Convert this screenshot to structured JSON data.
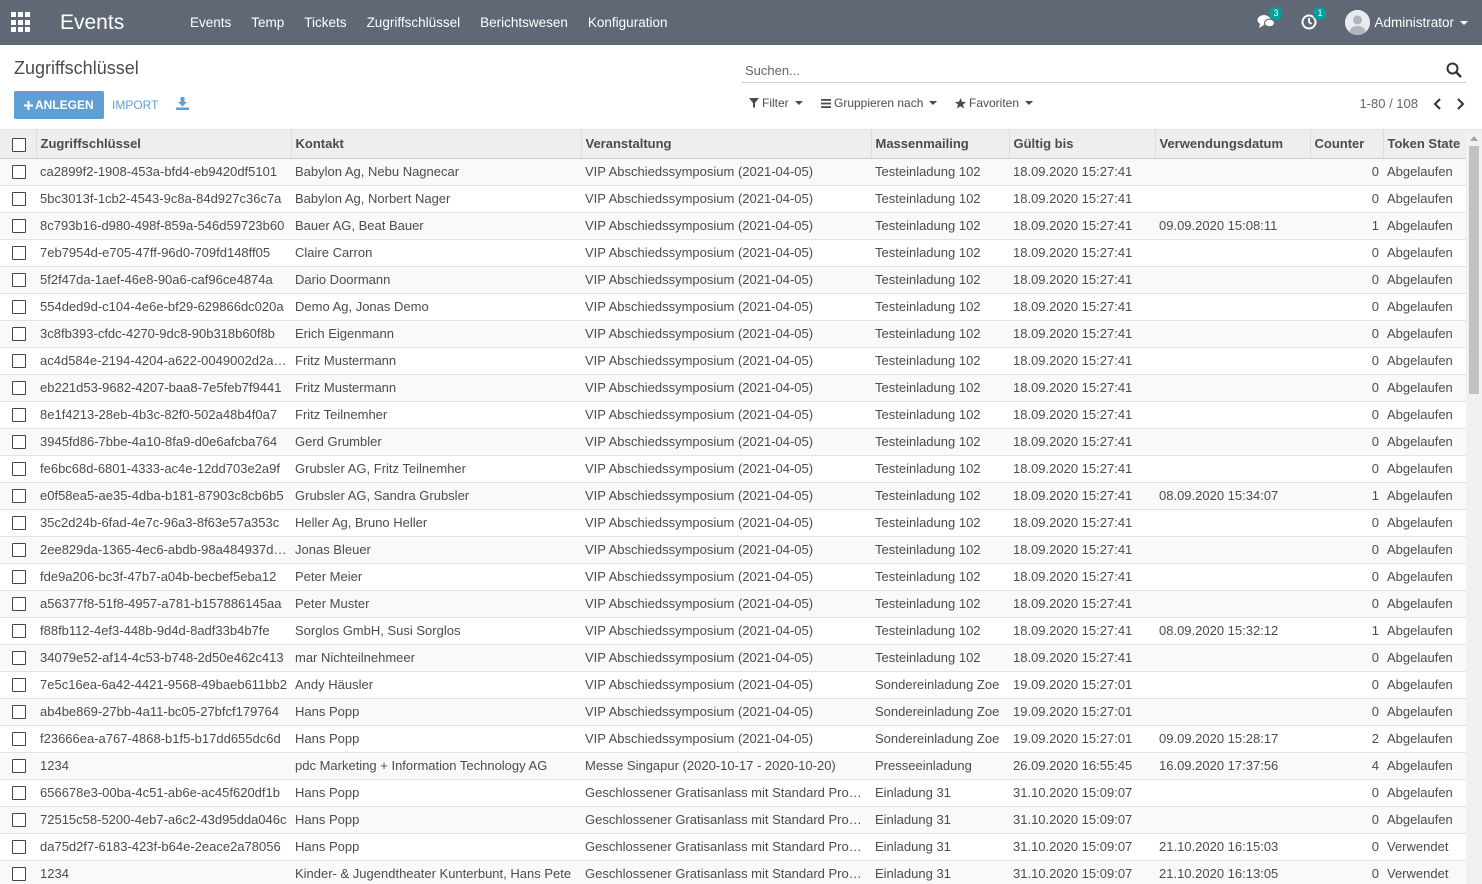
{
  "app": {
    "title": "Events",
    "menu": [
      "Events",
      "Temp",
      "Tickets",
      "Zugriffschlüssel",
      "Berichtswesen",
      "Konfiguration"
    ],
    "messages_count": "3",
    "activities_count": "1",
    "user_name": "Administrator"
  },
  "control": {
    "breadcrumb": "Zugriffschlüssel",
    "create_label": "ANLEGEN",
    "import_label": "IMPORT",
    "search_placeholder": "Suchen...",
    "filter_label": "Filter",
    "groupby_label": "Gruppieren nach",
    "favorites_label": "Favoriten",
    "pager": "1-80 / 108"
  },
  "table": {
    "headers": [
      "Zugriffschlüssel",
      "Kontakt",
      "Veranstaltung",
      "Massenmailing",
      "Gültig bis",
      "Verwendungsdatum",
      "Counter",
      "Token State"
    ],
    "rows": [
      [
        "ca2899f2-1908-453a-bfd4-eb9420df5101",
        "Babylon Ag, Nebu Nagnecar",
        "VIP Abschiedssymposium (2021-04-05)",
        "Testeinladung 102",
        "18.09.2020 15:27:41",
        "",
        "0",
        "Abgelaufen"
      ],
      [
        "5bc3013f-1cb2-4543-9c8a-84d927c36c7a",
        "Babylon Ag, Norbert Nager",
        "VIP Abschiedssymposium (2021-04-05)",
        "Testeinladung 102",
        "18.09.2020 15:27:41",
        "",
        "0",
        "Abgelaufen"
      ],
      [
        "8c793b16-d980-498f-859a-546d59723b60",
        "Bauer AG, Beat Bauer",
        "VIP Abschiedssymposium (2021-04-05)",
        "Testeinladung 102",
        "18.09.2020 15:27:41",
        "09.09.2020 15:08:11",
        "1",
        "Abgelaufen"
      ],
      [
        "7eb7954d-e705-47ff-96d0-709fd148ff05",
        "Claire Carron",
        "VIP Abschiedssymposium (2021-04-05)",
        "Testeinladung 102",
        "18.09.2020 15:27:41",
        "",
        "0",
        "Abgelaufen"
      ],
      [
        "5f2f47da-1aef-46e8-90a6-caf96ce4874a",
        "Dario Doormann",
        "VIP Abschiedssymposium (2021-04-05)",
        "Testeinladung 102",
        "18.09.2020 15:27:41",
        "",
        "0",
        "Abgelaufen"
      ],
      [
        "554ded9d-c104-4e6e-bf29-629866dc020a",
        "Demo Ag, Jonas Demo",
        "VIP Abschiedssymposium (2021-04-05)",
        "Testeinladung 102",
        "18.09.2020 15:27:41",
        "",
        "0",
        "Abgelaufen"
      ],
      [
        "3c8fb393-cfdc-4270-9dc8-90b318b60f8b",
        "Erich Eigenmann",
        "VIP Abschiedssymposium (2021-04-05)",
        "Testeinladung 102",
        "18.09.2020 15:27:41",
        "",
        "0",
        "Abgelaufen"
      ],
      [
        "ac4d584e-2194-4204-a622-0049002d2a93",
        "Fritz Mustermann",
        "VIP Abschiedssymposium (2021-04-05)",
        "Testeinladung 102",
        "18.09.2020 15:27:41",
        "",
        "0",
        "Abgelaufen"
      ],
      [
        "eb221d53-9682-4207-baa8-7e5feb7f9441",
        "Fritz Mustermann",
        "VIP Abschiedssymposium (2021-04-05)",
        "Testeinladung 102",
        "18.09.2020 15:27:41",
        "",
        "0",
        "Abgelaufen"
      ],
      [
        "8e1f4213-28eb-4b3c-82f0-502a48b4f0a7",
        "Fritz Teilnemher",
        "VIP Abschiedssymposium (2021-04-05)",
        "Testeinladung 102",
        "18.09.2020 15:27:41",
        "",
        "0",
        "Abgelaufen"
      ],
      [
        "3945fd86-7bbe-4a10-8fa9-d0e6afcba764",
        "Gerd Grumbler",
        "VIP Abschiedssymposium (2021-04-05)",
        "Testeinladung 102",
        "18.09.2020 15:27:41",
        "",
        "0",
        "Abgelaufen"
      ],
      [
        "fe6bc68d-6801-4333-ac4e-12dd703e2a9f",
        "Grubsler AG, Fritz Teilnemher",
        "VIP Abschiedssymposium (2021-04-05)",
        "Testeinladung 102",
        "18.09.2020 15:27:41",
        "",
        "0",
        "Abgelaufen"
      ],
      [
        "e0f58ea5-ae35-4dba-b181-87903c8cb6b5",
        "Grubsler AG, Sandra Grubsler",
        "VIP Abschiedssymposium (2021-04-05)",
        "Testeinladung 102",
        "18.09.2020 15:27:41",
        "08.09.2020 15:34:07",
        "1",
        "Abgelaufen"
      ],
      [
        "35c2d24b-6fad-4e7c-96a3-8f63e57a353c",
        "Heller Ag, Bruno Heller",
        "VIP Abschiedssymposium (2021-04-05)",
        "Testeinladung 102",
        "18.09.2020 15:27:41",
        "",
        "0",
        "Abgelaufen"
      ],
      [
        "2ee829da-1365-4ec6-abdb-98a484937d1a",
        "Jonas Bleuer",
        "VIP Abschiedssymposium (2021-04-05)",
        "Testeinladung 102",
        "18.09.2020 15:27:41",
        "",
        "0",
        "Abgelaufen"
      ],
      [
        "fde9a206-bc3f-47b7-a04b-becbef5eba12",
        "Peter Meier",
        "VIP Abschiedssymposium (2021-04-05)",
        "Testeinladung 102",
        "18.09.2020 15:27:41",
        "",
        "0",
        "Abgelaufen"
      ],
      [
        "a56377f8-51f8-4957-a781-b157886145aa",
        "Peter Muster",
        "VIP Abschiedssymposium (2021-04-05)",
        "Testeinladung 102",
        "18.09.2020 15:27:41",
        "",
        "0",
        "Abgelaufen"
      ],
      [
        "f88fb112-4ef3-448b-9d4d-8adf33b4b7fe",
        "Sorglos GmbH, Susi Sorglos",
        "VIP Abschiedssymposium (2021-04-05)",
        "Testeinladung 102",
        "18.09.2020 15:27:41",
        "08.09.2020 15:32:12",
        "1",
        "Abgelaufen"
      ],
      [
        "34079e52-af14-4c53-b748-2d50e462c413",
        "mar Nichteilnehmeer",
        "VIP Abschiedssymposium (2021-04-05)",
        "Testeinladung 102",
        "18.09.2020 15:27:41",
        "",
        "0",
        "Abgelaufen"
      ],
      [
        "7e5c16ea-6a42-4421-9568-49baeb611bb2",
        "Andy Häusler",
        "VIP Abschiedssymposium (2021-04-05)",
        "Sondereinladung Zoe",
        "19.09.2020 15:27:01",
        "",
        "0",
        "Abgelaufen"
      ],
      [
        "ab4be869-27bb-4a11-bc05-27bfcf179764",
        "Hans Popp",
        "VIP Abschiedssymposium (2021-04-05)",
        "Sondereinladung Zoe",
        "19.09.2020 15:27:01",
        "",
        "0",
        "Abgelaufen"
      ],
      [
        "f23666ea-a767-4868-b1f5-b17dd655dc6d",
        "Hans Popp",
        "VIP Abschiedssymposium (2021-04-05)",
        "Sondereinladung Zoe",
        "19.09.2020 15:27:01",
        "09.09.2020 15:28:17",
        "2",
        "Abgelaufen"
      ],
      [
        "1234",
        "pdc Marketing + Information Technology AG",
        "Messe Singapur (2020-10-17 - 2020-10-20)",
        "Presseeinladung",
        "26.09.2020 16:55:45",
        "16.09.2020 17:37:56",
        "4",
        "Abgelaufen"
      ],
      [
        "656678e3-00ba-4c51-ab6e-ac45f620df1b",
        "Hans Popp",
        "Geschlossener Gratisanlass mit Standard Prozess",
        "Einladung 31",
        "31.10.2020 15:09:07",
        "",
        "0",
        "Abgelaufen"
      ],
      [
        "72515c58-5200-4eb7-a6c2-43d95dda046c",
        "Hans Popp",
        "Geschlossener Gratisanlass mit Standard Prozess",
        "Einladung 31",
        "31.10.2020 15:09:07",
        "",
        "0",
        "Abgelaufen"
      ],
      [
        "da75d2f7-6183-423f-b64e-2eace2a78056",
        "Hans Popp",
        "Geschlossener Gratisanlass mit Standard Prozess",
        "Einladung 31",
        "31.10.2020 15:09:07",
        "21.10.2020 16:15:03",
        "0",
        "Verwendet"
      ],
      [
        "1234",
        "Kinder- & Jugendtheater Kunterbunt, Hans Pete",
        "Geschlossener Gratisanlass mit Standard Prozess",
        "Einladung 31",
        "31.10.2020 15:09:07",
        "21.10.2020 16:13:05",
        "0",
        "Verwendet"
      ]
    ]
  },
  "colors": {
    "navbar": "#5f6874",
    "primary": "#5ea0d6",
    "badge": "#00a09d",
    "header_bg": "#eeeeee"
  }
}
